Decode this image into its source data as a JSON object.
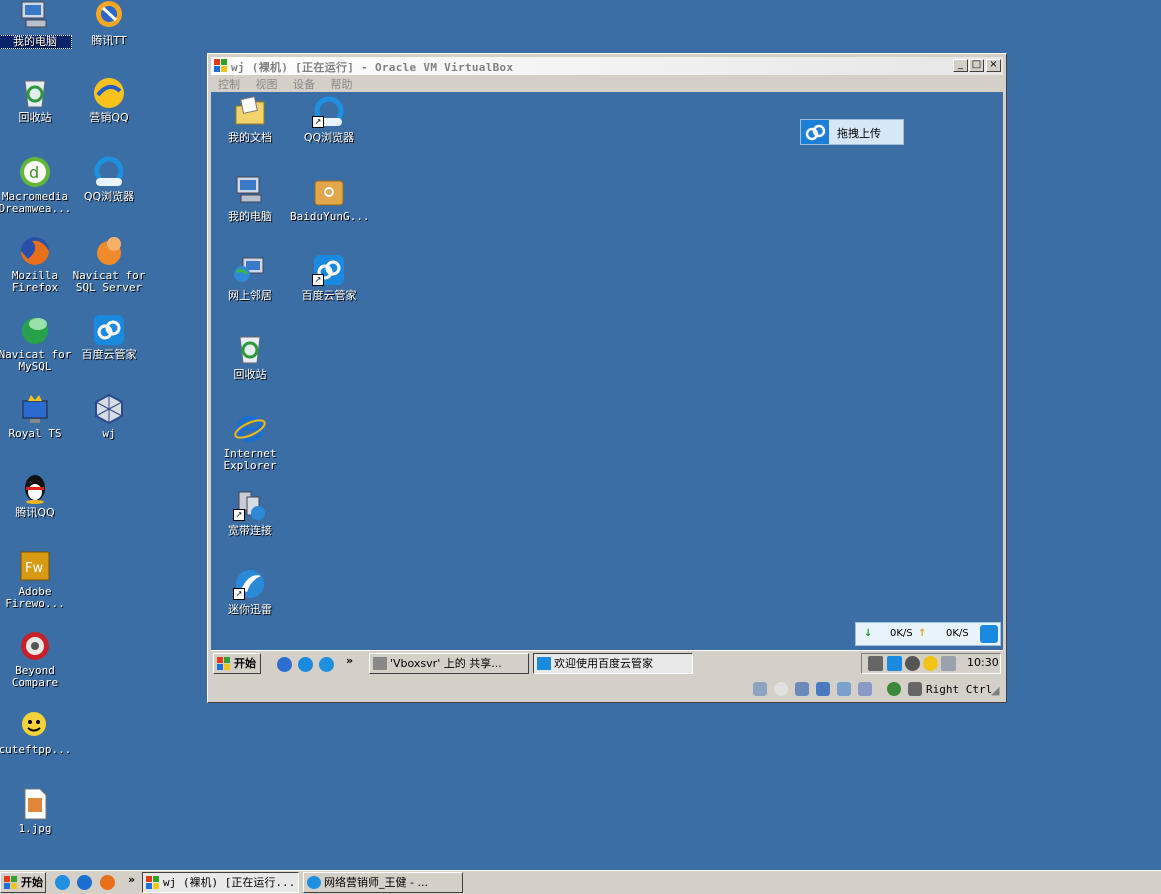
{
  "desktop": {
    "icons": [
      {
        "label": "我的电脑",
        "icon": "my-computer-icon"
      },
      {
        "label": "腾讯TT",
        "icon": "tencent-tt-icon"
      },
      {
        "label": "回收站",
        "icon": "recycle-bin-icon"
      },
      {
        "label": "营销QQ",
        "icon": "marketing-qq-icon"
      },
      {
        "label": "Macromedia\nDreamwea...",
        "icon": "dreamweaver-icon"
      },
      {
        "label": "QQ浏览器",
        "icon": "qq-browser-icon"
      },
      {
        "label": "Mozilla\nFirefox",
        "icon": "firefox-icon"
      },
      {
        "label": "Navicat for\nSQL Server",
        "icon": "navicat-sqlserver-icon"
      },
      {
        "label": "Navicat for\nMySQL",
        "icon": "navicat-mysql-icon"
      },
      {
        "label": "百度云管家",
        "icon": "baidu-cloud-icon"
      },
      {
        "label": "Royal TS",
        "icon": "royal-ts-icon"
      },
      {
        "label": "wj",
        "icon": "virtualbox-vm-icon"
      },
      {
        "label": "腾讯QQ",
        "icon": "tencent-qq-icon"
      },
      {
        "label": "Adobe\nFirewo...",
        "icon": "fireworks-icon"
      },
      {
        "label": "Beyond\nCompare",
        "icon": "beyond-compare-icon"
      },
      {
        "label": "cuteftpp...",
        "icon": "cuteftp-icon"
      },
      {
        "label": "1.jpg",
        "icon": "jpg-file-icon"
      }
    ]
  },
  "vm_window": {
    "title": "wj (裸机) [正在运行] - Oracle VM VirtualBox",
    "buttons": {
      "minimize": "_",
      "maximize": "□",
      "close": "×"
    },
    "menu": [
      "控制",
      "视图",
      "设备",
      "帮助"
    ],
    "guest": {
      "icons": [
        {
          "label": "我的文档",
          "icon": "my-documents-icon",
          "shortcut": false
        },
        {
          "label": "QQ浏览器",
          "icon": "qq-browser-icon",
          "shortcut": true
        },
        {
          "label": "我的电脑",
          "icon": "my-computer-icon",
          "shortcut": false
        },
        {
          "label": "BaiduYunG...",
          "icon": "baidu-yun-folder-icon",
          "shortcut": false
        },
        {
          "label": "网上邻居",
          "icon": "network-places-icon",
          "shortcut": false
        },
        {
          "label": "百度云管家",
          "icon": "baidu-cloud-icon",
          "shortcut": true
        },
        {
          "label": "回收站",
          "icon": "recycle-bin-icon",
          "shortcut": false
        },
        {
          "label": "Internet\nExplorer",
          "icon": "internet-explorer-icon",
          "shortcut": false
        },
        {
          "label": "宽带连接",
          "icon": "broadband-connection-icon",
          "shortcut": true
        },
        {
          "label": "迷你迅雷",
          "icon": "mini-thunder-icon",
          "shortcut": true
        }
      ],
      "drag_upload": "拖拽上传",
      "speed": {
        "down": "0K/S",
        "up": "0K/S"
      },
      "taskbar": {
        "start": "开始",
        "quick_more": "»",
        "tasks": [
          "'Vboxsvr' 上的 共享...",
          "欢迎使用百度云管家"
        ],
        "clock": "10:30"
      }
    },
    "status": {
      "host_key": "Right Ctrl"
    }
  },
  "host_taskbar": {
    "start": "开始",
    "quick_more": "»",
    "tasks": [
      "wj (裸机) [正在运行...",
      "网络营销师_王健 - ..."
    ]
  }
}
